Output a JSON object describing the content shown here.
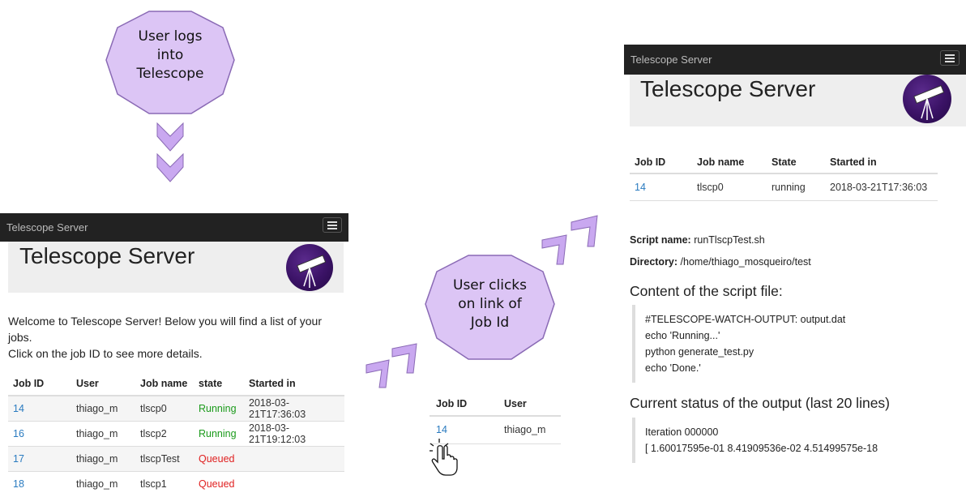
{
  "callouts": {
    "login": [
      "User logs",
      "into",
      "Telescope"
    ],
    "click": [
      "User clicks",
      "on link of",
      "Job Id"
    ]
  },
  "left_panel": {
    "navbar_brand": "Telescope Server",
    "title": "Telescope Server",
    "welcome_line1": "Welcome to Telescope Server! Below you will find a list of your jobs.",
    "welcome_line2": "Click on the job ID to see more details.",
    "table": {
      "headers": [
        "Job ID",
        "User",
        "Job name",
        "state",
        "Started in"
      ],
      "rows": [
        {
          "id": "14",
          "user": "thiago_m",
          "name": "tlscp0",
          "state": "Running",
          "started": "2018-03-21T17:36:03"
        },
        {
          "id": "16",
          "user": "thiago_m",
          "name": "tlscp2",
          "state": "Running",
          "started": "2018-03-21T19:12:03"
        },
        {
          "id": "17",
          "user": "thiago_m",
          "name": "tlscpTest",
          "state": "Queued",
          "started": ""
        },
        {
          "id": "18",
          "user": "thiago_m",
          "name": "tlscp1",
          "state": "Queued",
          "started": ""
        }
      ]
    }
  },
  "middle_snippet": {
    "headers": [
      "Job ID",
      "User"
    ],
    "row": {
      "id": "14",
      "user": "thiago_m"
    }
  },
  "right_panel": {
    "navbar_brand": "Telescope Server",
    "title": "Telescope Server",
    "table": {
      "headers": [
        "Job ID",
        "Job name",
        "State",
        "Started in"
      ],
      "row": {
        "id": "14",
        "name": "tlscp0",
        "state": "running",
        "started": "2018-03-21T17:36:03"
      }
    },
    "script_name_label": "Script name:",
    "script_name": "runTlscpTest.sh",
    "directory_label": "Directory:",
    "directory": "/home/thiago_mosqueiro/test",
    "content_heading": "Content of the script file:",
    "script_lines": [
      "#TELESCOPE-WATCH-OUTPUT: output.dat",
      "echo 'Running...'",
      "python generate_test.py",
      "echo 'Done.'"
    ],
    "status_heading": "Current status of the output (last 20 lines)",
    "output_lines": [
      "Iteration 000000",
      "[ 1.60017595e-01 8.41909536e-02 4.51499575e-18"
    ]
  },
  "colors": {
    "callout_fill": "#dcc5f5",
    "callout_stroke": "#8a6ab5",
    "arrow_fill": "#c9a8f0",
    "navbar": "#222222",
    "jumbotron": "#eeeeee",
    "link": "#2a7bc0",
    "running": "#1a9a1a",
    "queued": "#e02020"
  },
  "icons": [
    "telescope-logo-icon",
    "hamburger-menu-icon",
    "hand-pointer-icon",
    "chevron-down-icon",
    "chevron-arrow-icon"
  ]
}
